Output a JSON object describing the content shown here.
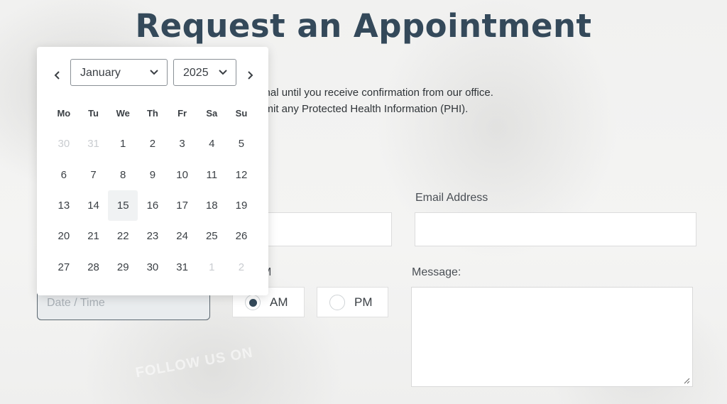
{
  "page": {
    "title": "Request an Appointment",
    "notice_line1": "not final until you receive confirmation from our office.",
    "notice_line2": "t submit any Protected Health Information (PHI).",
    "background_text": "FOLLOW US ON"
  },
  "form": {
    "email_label": "Email Address",
    "email_value": "",
    "name_value": "",
    "ampm_label_fragment": "M",
    "am_label": "AM",
    "pm_label": "PM",
    "ampm_selected": "AM",
    "datetime_placeholder": "Date / Time",
    "message_label": "Message:",
    "message_value": ""
  },
  "datepicker": {
    "month": "January",
    "year": "2025",
    "weekdays": [
      "Mo",
      "Tu",
      "We",
      "Th",
      "Fr",
      "Sa",
      "Su"
    ],
    "weeks": [
      [
        {
          "d": "30",
          "muted": true
        },
        {
          "d": "31",
          "muted": true
        },
        {
          "d": "1"
        },
        {
          "d": "2"
        },
        {
          "d": "3"
        },
        {
          "d": "4"
        },
        {
          "d": "5"
        }
      ],
      [
        {
          "d": "6"
        },
        {
          "d": "7"
        },
        {
          "d": "8"
        },
        {
          "d": "9"
        },
        {
          "d": "10"
        },
        {
          "d": "11"
        },
        {
          "d": "12"
        }
      ],
      [
        {
          "d": "13"
        },
        {
          "d": "14"
        },
        {
          "d": "15",
          "today": true
        },
        {
          "d": "16"
        },
        {
          "d": "17"
        },
        {
          "d": "18"
        },
        {
          "d": "19"
        }
      ],
      [
        {
          "d": "20"
        },
        {
          "d": "21"
        },
        {
          "d": "22"
        },
        {
          "d": "23"
        },
        {
          "d": "24"
        },
        {
          "d": "25"
        },
        {
          "d": "26"
        }
      ],
      [
        {
          "d": "27"
        },
        {
          "d": "28"
        },
        {
          "d": "29"
        },
        {
          "d": "30"
        },
        {
          "d": "31"
        },
        {
          "d": "1",
          "muted": true
        },
        {
          "d": "2",
          "muted": true
        }
      ]
    ],
    "prev_icon": "chevron-left-icon",
    "next_icon": "chevron-right-icon"
  },
  "colors": {
    "title": "#34495a",
    "accent": "#34495a",
    "muted_day": "#c9ccd0"
  }
}
